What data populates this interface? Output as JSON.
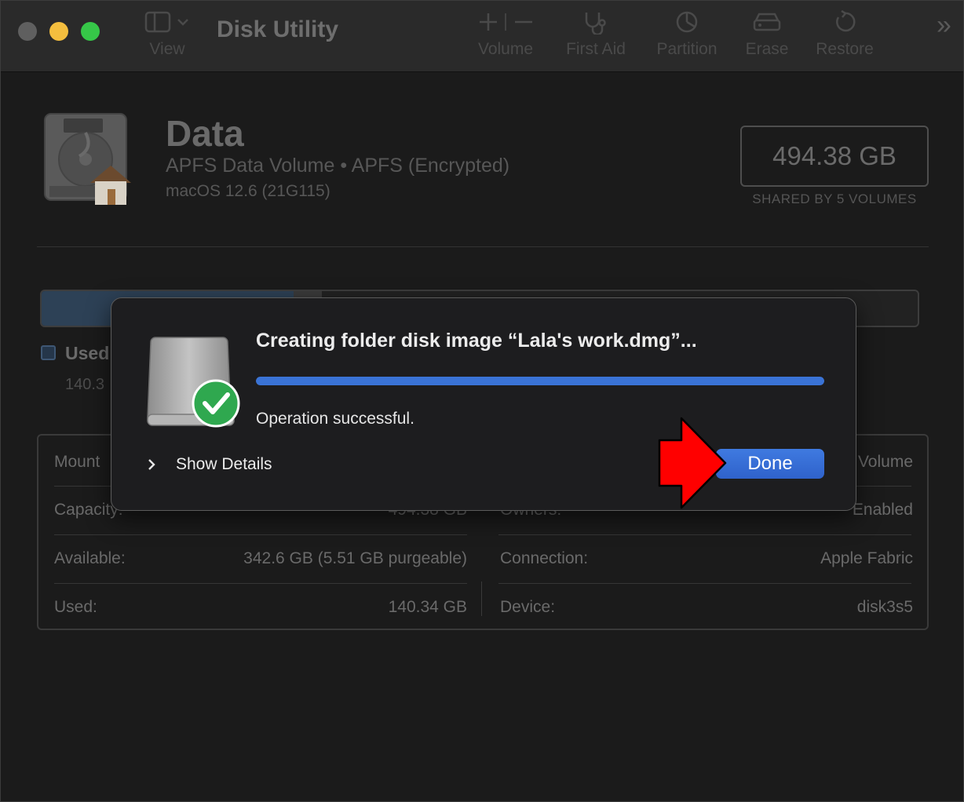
{
  "toolbar": {
    "app_title": "Disk Utility",
    "view_label": "View",
    "volume_label": "Volume",
    "first_aid_label": "First Aid",
    "partition_label": "Partition",
    "erase_label": "Erase",
    "restore_label": "Restore"
  },
  "volume": {
    "name": "Data",
    "subtitle": "APFS Data Volume • APFS (Encrypted)",
    "os": "macOS 12.6 (21G115)",
    "capacity": "494.38 GB",
    "capacity_note": "SHARED BY 5 VOLUMES"
  },
  "usage": {
    "used_fraction": 0.288,
    "legend_label": "Used",
    "legend_value": "140.3"
  },
  "info": {
    "left": [
      {
        "label": "Mount",
        "value": ""
      },
      {
        "label": "Capacity:",
        "value": "494.38 GB"
      },
      {
        "label": "Available:",
        "value": "342.6 GB (5.51 GB purgeable)"
      },
      {
        "label": "Used:",
        "value": "140.34 GB"
      }
    ],
    "right": [
      {
        "label": "",
        "value": "Volume"
      },
      {
        "label": "Owners:",
        "value": "Enabled"
      },
      {
        "label": "Connection:",
        "value": "Apple Fabric"
      },
      {
        "label": "Device:",
        "value": "disk3s5"
      }
    ]
  },
  "dialog": {
    "title": "Creating folder disk image “Lala's work.dmg”...",
    "progress": 1.0,
    "status": "Operation successful.",
    "show_details_label": "Show Details",
    "done_label": "Done"
  },
  "colors": {
    "accent": "#3a73d6",
    "done_button": "#3468cf",
    "success_check": "#2fa84f",
    "annotation_arrow": "#ff0000"
  }
}
